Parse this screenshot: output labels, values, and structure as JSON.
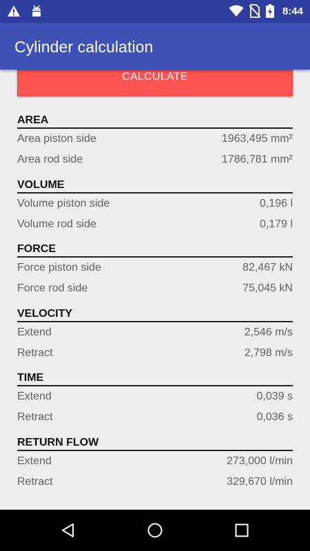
{
  "status_bar": {
    "time": "8:44",
    "icons": [
      "warning-icon",
      "android-icon",
      "wifi-icon",
      "no-sim-icon",
      "battery-charging-icon"
    ]
  },
  "app_bar": {
    "title": "Cylinder calculation"
  },
  "calculate_button": {
    "label": "CALCULATE"
  },
  "sections": [
    {
      "title": "AREA",
      "rows": [
        {
          "label": "Area piston side",
          "value": "1963,495 mm²"
        },
        {
          "label": "Area rod side",
          "value": "1786,781 mm²"
        }
      ]
    },
    {
      "title": "VOLUME",
      "rows": [
        {
          "label": "Volume piston side",
          "value": "0,196 l"
        },
        {
          "label": "Volume rod side",
          "value": "0,179 l"
        }
      ]
    },
    {
      "title": "FORCE",
      "rows": [
        {
          "label": "Force piston side",
          "value": "82,467 kN"
        },
        {
          "label": "Force rod side",
          "value": "75,045 kN"
        }
      ]
    },
    {
      "title": "VELOCITY",
      "rows": [
        {
          "label": "Extend",
          "value": "2,546 m/s"
        },
        {
          "label": "Retract",
          "value": "2,798 m/s"
        }
      ]
    },
    {
      "title": "TIME",
      "rows": [
        {
          "label": "Extend",
          "value": "0,039 s"
        },
        {
          "label": "Retract",
          "value": "0,036 s"
        }
      ]
    },
    {
      "title": "RETURN FLOW",
      "rows": [
        {
          "label": "Extend",
          "value": "273,000 l/min"
        },
        {
          "label": "Retract",
          "value": "329,670 l/min"
        }
      ]
    }
  ],
  "nav_bar": {
    "icons": [
      "back-icon",
      "home-icon",
      "recents-icon"
    ]
  }
}
